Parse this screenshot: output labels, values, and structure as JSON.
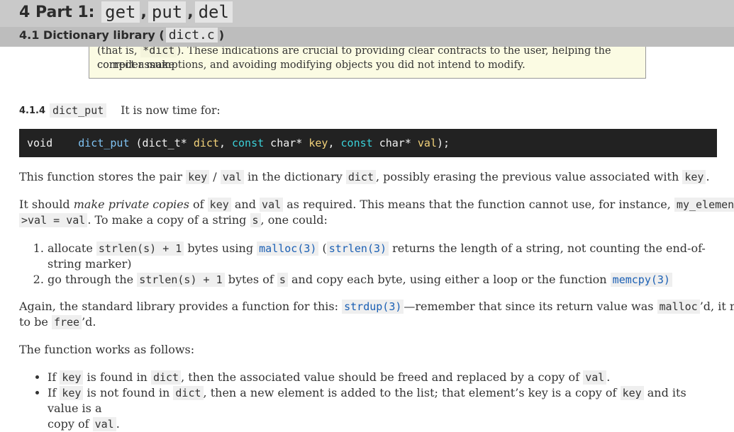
{
  "header": {
    "h1_prefix": "4 Part 1:",
    "h1_codes": [
      "get",
      "put",
      "del"
    ],
    "h1_sep": ",",
    "h2_prefix": "4.1 Dictionary library (",
    "h2_code": "dict.c",
    "h2_suffix": ")"
  },
  "note": {
    "line1_pre": "(that is,",
    "line1_code": "*dict",
    "line1_post": "). These indications are crucial to providing clear contracts to the user, helping the compiler make",
    "line2": "correct assumptions, and avoiding modifying objects you did not intend to modify."
  },
  "section": {
    "number": "4.1.4",
    "title": "dict_put",
    "after": "It is now time for:"
  },
  "code_tokens": {
    "t1": "void",
    "t2": "dict_put",
    "t3": " (dict_t* ",
    "t4": "dict",
    "t5": ", ",
    "t6": "const",
    "t7": " char* ",
    "t8": "key",
    "t9": ", ",
    "t10": "const",
    "t11": " char* ",
    "t12": "val",
    "t13": ");"
  },
  "p1": {
    "a": "This function stores the pair",
    "c1": "key",
    "b": "/",
    "c2": "val",
    "c": "in the dictionary",
    "c3": "dict",
    "d": ", possibly erasing the previous value associated with",
    "c4": "key",
    "e": "."
  },
  "p2": {
    "a": "It should",
    "em": "make private copies",
    "b": "of",
    "c1": "key",
    "c": "and",
    "c2": "val",
    "d": "as required. This means that the function cannot use, for instance,",
    "c3a": "my_element-",
    "c3b": ">val = val",
    "e": ". To make a copy of a string",
    "c4": "s",
    "f": ", one could:"
  },
  "ol": {
    "i1_a": "allocate",
    "i1_c1": "strlen(s) + 1",
    "i1_b": "bytes using",
    "i1_c2": "malloc(3)",
    "i1_c": "(",
    "i1_c3": "strlen(3)",
    "i1_d": "returns the length of a string, not counting the end-of-",
    "i1_e": "string marker)",
    "i2_a": "go through the",
    "i2_c1": "strlen(s) + 1",
    "i2_b": "bytes of",
    "i2_c2": "s",
    "i2_c": "and copy each byte, using either a loop or the function",
    "i2_c3": "memcpy(3)"
  },
  "p3": {
    "a": "Again, the standard library provides a function for this:",
    "c1": "strdup(3)",
    "b": "—remember that since its return value was",
    "c2": "malloc",
    "c": "’d, it needs",
    "d": "to be",
    "c3": "free",
    "e": "’d."
  },
  "p4": "The function works as follows:",
  "ul": {
    "i1_a": "If",
    "i1_c1": "key",
    "i1_b": "is found in",
    "i1_c2": "dict",
    "i1_c": ", then the associated value should be freed and replaced by a copy of",
    "i1_c3": "val",
    "i1_d": ".",
    "i2_a": "If",
    "i2_c1": "key",
    "i2_b": "is not found in",
    "i2_c2": "dict",
    "i2_c": ", then a new element is added to the list; that element’s key is a copy of",
    "i2_c3": "key",
    "i2_d": "and its value is a",
    "i2_e": "copy of",
    "i2_c4": "val",
    "i2_f": "."
  }
}
